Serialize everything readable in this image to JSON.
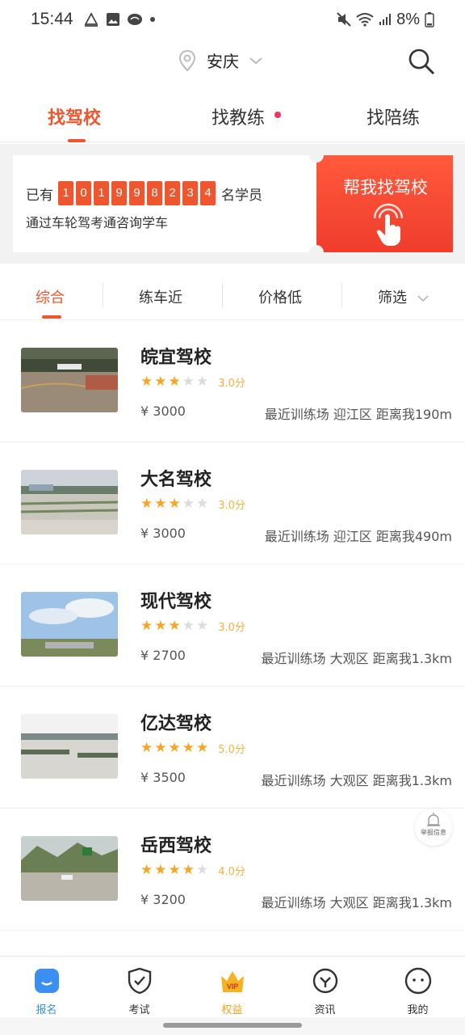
{
  "status_bar": {
    "time": "15:44",
    "battery": "8%"
  },
  "location": {
    "city": "安庆"
  },
  "tabs": [
    {
      "label": "找驾校",
      "active": true
    },
    {
      "label": "找教练",
      "active": false,
      "badge_dot": true
    },
    {
      "label": "找陪练",
      "active": false
    }
  ],
  "banner": {
    "prefix": "已有",
    "digits": [
      "1",
      "0",
      "1",
      "9",
      "9",
      "8",
      "2",
      "3",
      "4"
    ],
    "suffix": "名学员",
    "subtitle": "通过车轮驾考通咨询学车",
    "cta": "帮我找驾校"
  },
  "filters": [
    {
      "label": "综合",
      "active": true
    },
    {
      "label": "练车近",
      "active": false
    },
    {
      "label": "价格低",
      "active": false
    },
    {
      "label": "筛选",
      "active": false,
      "dropdown": true
    }
  ],
  "schools": [
    {
      "name": "皖宜驾校",
      "stars": 3,
      "score": "3.0分",
      "price": "¥ 3000",
      "location": "最近训练场 迎江区 距离我190m"
    },
    {
      "name": "大名驾校",
      "stars": 3,
      "score": "3.0分",
      "price": "¥ 3000",
      "location": "最近训练场 迎江区 距离我490m"
    },
    {
      "name": "现代驾校",
      "stars": 3,
      "score": "3.0分",
      "price": "¥ 2700",
      "location": "最近训练场 大观区 距离我1.3km"
    },
    {
      "name": "亿达驾校",
      "stars": 5,
      "score": "5.0分",
      "price": "¥ 3500",
      "location": "最近训练场 大观区 距离我1.3km"
    },
    {
      "name": "岳西驾校",
      "stars": 4,
      "score": "4.0分",
      "price": "¥ 3200",
      "location": "最近训练场 大观区 距离我1.3km"
    }
  ],
  "report_button": {
    "label": "举报信息"
  },
  "bottom_nav": [
    {
      "label": "报名",
      "icon": "signup-icon",
      "active": true
    },
    {
      "label": "考试",
      "icon": "exam-shield-icon",
      "active": false
    },
    {
      "label": "权益",
      "icon": "vip-crown-icon",
      "active": false
    },
    {
      "label": "资讯",
      "icon": "news-icon",
      "active": false
    },
    {
      "label": "我的",
      "icon": "profile-icon",
      "active": false
    }
  ],
  "colors": {
    "accent": "#f0562e",
    "star": "#f6a623",
    "active_nav": "#2f90ea",
    "vip": "#f0a21d"
  }
}
